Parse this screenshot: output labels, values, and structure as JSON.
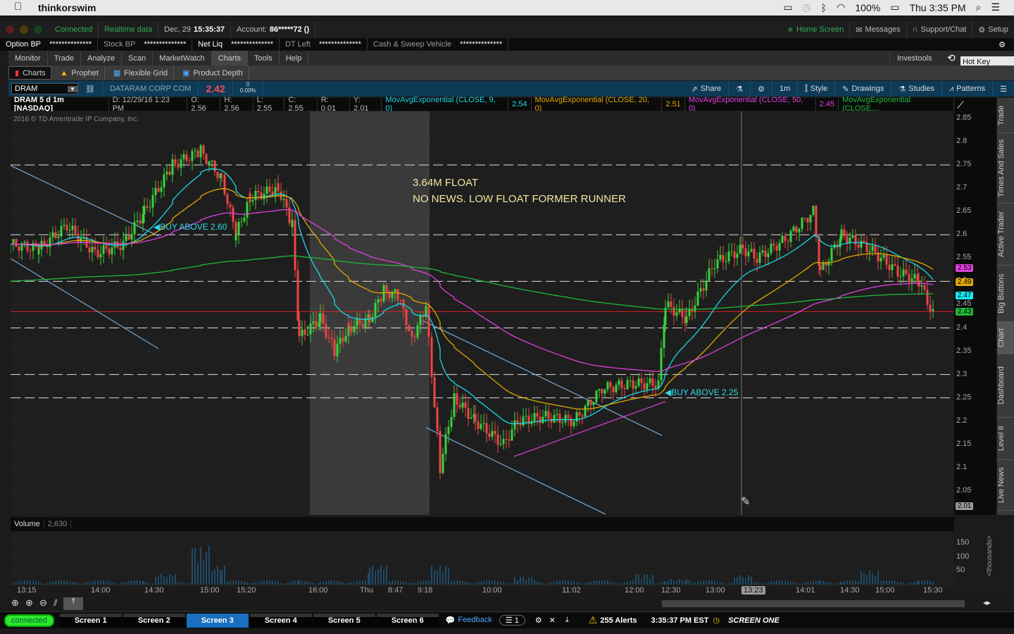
{
  "macos": {
    "app": "thinkorswim",
    "battery": "100%",
    "clock": "Thu 3:35 PM"
  },
  "header": {
    "connected": "Connected",
    "realtime": "Realtime data",
    "date": "Dec, 29",
    "time": "15:35:37",
    "account_label": "Account:",
    "account": "86*****72 ()",
    "home": "Home Screen",
    "messages": "Messages",
    "support": "Support/Chat",
    "setup": "Setup"
  },
  "balances": [
    {
      "label": "Option BP",
      "value": "**************"
    },
    {
      "label": "Stock BP",
      "value": "**************"
    },
    {
      "label": "Net Liq",
      "value": "**************"
    },
    {
      "label": "DT Left",
      "value": "**************"
    },
    {
      "label": "Cash & Sweep Vehicle",
      "value": "**************"
    }
  ],
  "menu": [
    "Monitor",
    "Trade",
    "Analyze",
    "Scan",
    "MarketWatch",
    "Charts",
    "Tools",
    "Help"
  ],
  "menu_right": "Investools",
  "tooltip": "Hot Key Setup",
  "subtabs": [
    "Charts",
    "Prophet",
    "Flexible Grid",
    "Product Depth"
  ],
  "toolbar": {
    "symbol": "DRAM",
    "company": "DATARAM CORP COM",
    "last": "2.42",
    "change": "0",
    "change_pct": "0.00%",
    "share": "Share",
    "timeframe": "1m",
    "style": "Style",
    "drawings": "Drawings",
    "studies": "Studies",
    "patterns": "Patterns"
  },
  "info": {
    "title": "DRAM 5 d 1m [NASDAQ]",
    "d": "D: 12/29/16 1:23 PM",
    "o": "O: 2.56",
    "h": "H: 2.56",
    "l": "L: 2.55",
    "c": "C: 2.55",
    "r": "R: 0.01",
    "y": "Y: 2.01",
    "studies": [
      {
        "name": "MovAvgExponential (CLOSE, 9, 0)",
        "value": "2.54",
        "color": "#19d8e8"
      },
      {
        "name": "MovAvgExponential (CLOSE, 20, 0)",
        "value": "2.51",
        "color": "#e0a800"
      },
      {
        "name": "MovAvgExponential (CLOSE, 50, 0)",
        "value": "2.45",
        "color": "#e040e0"
      },
      {
        "name": "MovAvgExponential (CLOSE,...",
        "value": "",
        "color": "#1fb83a"
      }
    ]
  },
  "copyright": "2016 © TD Ameritrade IP Company, Inc.",
  "annotations": {
    "float": "3.64M FLOAT",
    "news": "NO NEWS. LOW FLOAT FORMER RUNNER",
    "buy1": "BUY ABOVE 2.60",
    "buy2": "BUY ABOVE 2.25"
  },
  "price_axis": [
    "2.85",
    "2.8",
    "2.75",
    "2.7",
    "2.65",
    "2.6",
    "2.55",
    "2.5",
    "2.45",
    "2.4",
    "2.35",
    "2.3",
    "2.25",
    "2.2",
    "2.15",
    "2.1",
    "2.05"
  ],
  "price_badges": [
    {
      "v": "2.53",
      "color": "#e040e0"
    },
    {
      "v": "2.49",
      "color": "#e0a800"
    },
    {
      "v": "2.47",
      "color": "#19e8f0"
    },
    {
      "v": "2.43",
      "color": "#1fb83a"
    },
    {
      "v": "2.01",
      "color": "#999999"
    }
  ],
  "side_tabs": [
    "Trade",
    "Times And Sales",
    "Active Trader",
    "Big Buttons",
    "Chart",
    "Dashboard",
    "Level II",
    "Live News"
  ],
  "volume": {
    "label": "Volume",
    "value": "2,630",
    "axis": [
      "150",
      "100",
      "50"
    ],
    "unit": "<thousands>"
  },
  "time_axis": [
    "13:15",
    "14:00",
    "14:30",
    "15:00",
    "15:20",
    "16:00",
    "Thu",
    "8:47",
    "9:18",
    "10:00",
    "11:02",
    "12:00",
    "12:30",
    "13:00",
    "14:01",
    "14:30",
    "15:00",
    "15:30"
  ],
  "cursor_time": "13:23",
  "status": {
    "connected": "connected",
    "screens": [
      "Screen 1",
      "Screen 2",
      "Screen 3",
      "Screen 4",
      "Screen 5",
      "Screen 6"
    ],
    "active_screen": 2,
    "feedback": "Feedback",
    "count": "1",
    "alerts": "255 Alerts",
    "clock": "3:35:37 PM EST",
    "screen_name": "SCREEN ONE"
  },
  "chart_data": {
    "type": "candlestick",
    "symbol": "DRAM",
    "ylim": [
      2.0,
      2.87
    ],
    "close_path": [
      [
        0,
        2.58
      ],
      [
        4,
        2.57
      ],
      [
        8,
        2.62
      ],
      [
        12,
        2.56
      ],
      [
        16,
        2.58
      ],
      [
        19,
        2.65
      ],
      [
        23,
        2.75
      ],
      [
        27,
        2.78
      ],
      [
        30,
        2.72
      ],
      [
        32,
        2.6
      ],
      [
        34,
        2.68
      ],
      [
        38,
        2.7
      ],
      [
        40,
        2.62
      ],
      [
        41,
        2.38
      ],
      [
        44,
        2.42
      ],
      [
        46,
        2.35
      ],
      [
        48,
        2.4
      ],
      [
        51,
        2.42
      ],
      [
        53,
        2.48
      ],
      [
        55,
        2.47
      ],
      [
        57,
        2.38
      ],
      [
        59,
        2.44
      ],
      [
        61,
        2.1
      ],
      [
        63,
        2.25
      ],
      [
        66,
        2.2
      ],
      [
        70,
        2.15
      ],
      [
        72,
        2.2
      ],
      [
        76,
        2.21
      ],
      [
        80,
        2.2
      ],
      [
        84,
        2.27
      ],
      [
        88,
        2.28
      ],
      [
        92,
        2.28
      ],
      [
        93,
        2.45
      ],
      [
        96,
        2.42
      ],
      [
        100,
        2.54
      ],
      [
        104,
        2.57
      ],
      [
        106,
        2.55
      ],
      [
        110,
        2.59
      ],
      [
        114,
        2.65
      ],
      [
        115,
        2.52
      ],
      [
        118,
        2.6
      ],
      [
        122,
        2.57
      ],
      [
        126,
        2.52
      ],
      [
        129,
        2.5
      ],
      [
        131,
        2.43
      ]
    ],
    "levels": [
      2.75,
      2.6,
      2.5,
      2.4,
      2.3,
      2.25
    ],
    "red_level": 2.435,
    "volume_spikes": [
      [
        22,
        40
      ],
      [
        27,
        140
      ],
      [
        29,
        70
      ],
      [
        52,
        70
      ],
      [
        61,
        70
      ],
      [
        68,
        15
      ],
      [
        73,
        30
      ],
      [
        90,
        40
      ],
      [
        95,
        20
      ],
      [
        104,
        35
      ],
      [
        122,
        50
      ]
    ]
  }
}
